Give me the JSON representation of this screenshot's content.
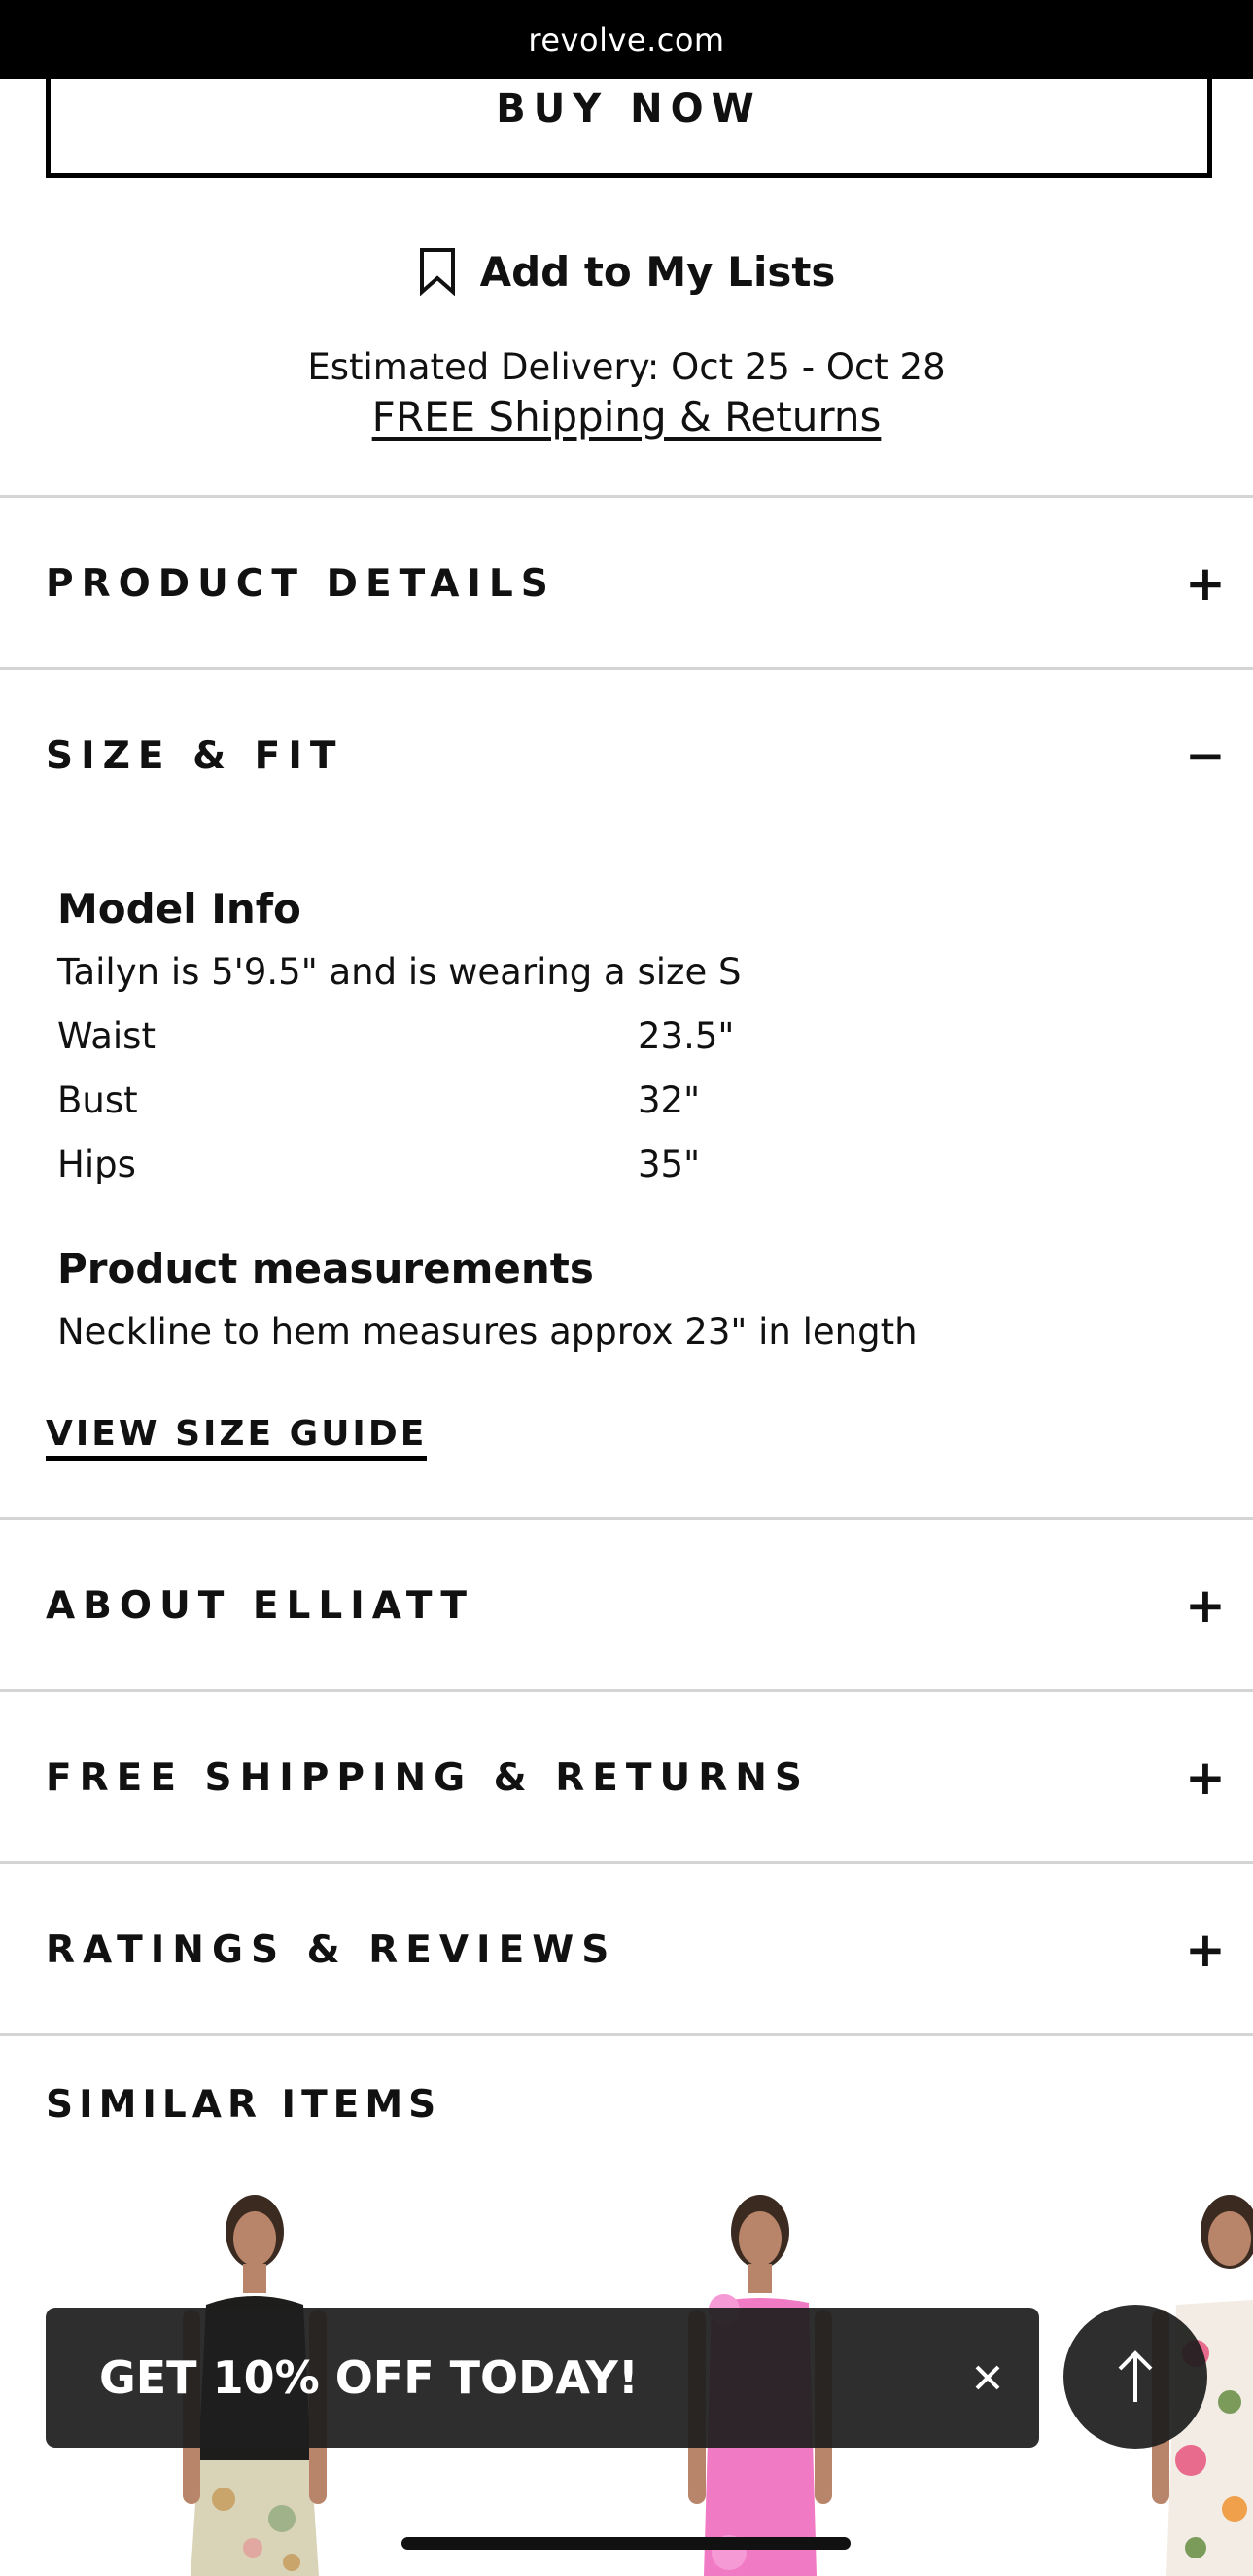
{
  "browser": {
    "url": "revolve.com"
  },
  "buy_now": {
    "label": "BUY NOW"
  },
  "lists": {
    "label": "Add to My Lists",
    "icon": "bookmark-icon"
  },
  "delivery": {
    "estimate": "Estimated Delivery: Oct 25 - Oct 28",
    "shipping_link": "FREE Shipping & Returns"
  },
  "accordions": {
    "product_details": {
      "title": "PRODUCT DETAILS",
      "toggle": "+"
    },
    "size_fit": {
      "title": "SIZE & FIT",
      "toggle": "−"
    },
    "about": {
      "title": "ABOUT ELLIATT",
      "toggle": "+"
    },
    "shipping": {
      "title": "FREE SHIPPING & RETURNS",
      "toggle": "+"
    },
    "reviews": {
      "title": "RATINGS & REVIEWS",
      "toggle": "+"
    }
  },
  "size_fit": {
    "model_heading": "Model Info",
    "model_text": "Tailyn is 5'9.5\" and is wearing a size S",
    "measurements": [
      {
        "label": "Waist",
        "value": "23.5\""
      },
      {
        "label": "Bust",
        "value": "32\""
      },
      {
        "label": "Hips",
        "value": "35\""
      }
    ],
    "product_heading": "Product measurements",
    "product_text": "Neckline to hem measures approx 23\" in length",
    "size_guide": "VIEW SIZE GUIDE"
  },
  "similar": {
    "title": "SIMILAR ITEMS"
  },
  "promo": {
    "text": "GET 10% OFF TODAY!",
    "close_icon": "close-icon"
  },
  "scroll_top": {
    "icon": "arrow-up-icon"
  }
}
